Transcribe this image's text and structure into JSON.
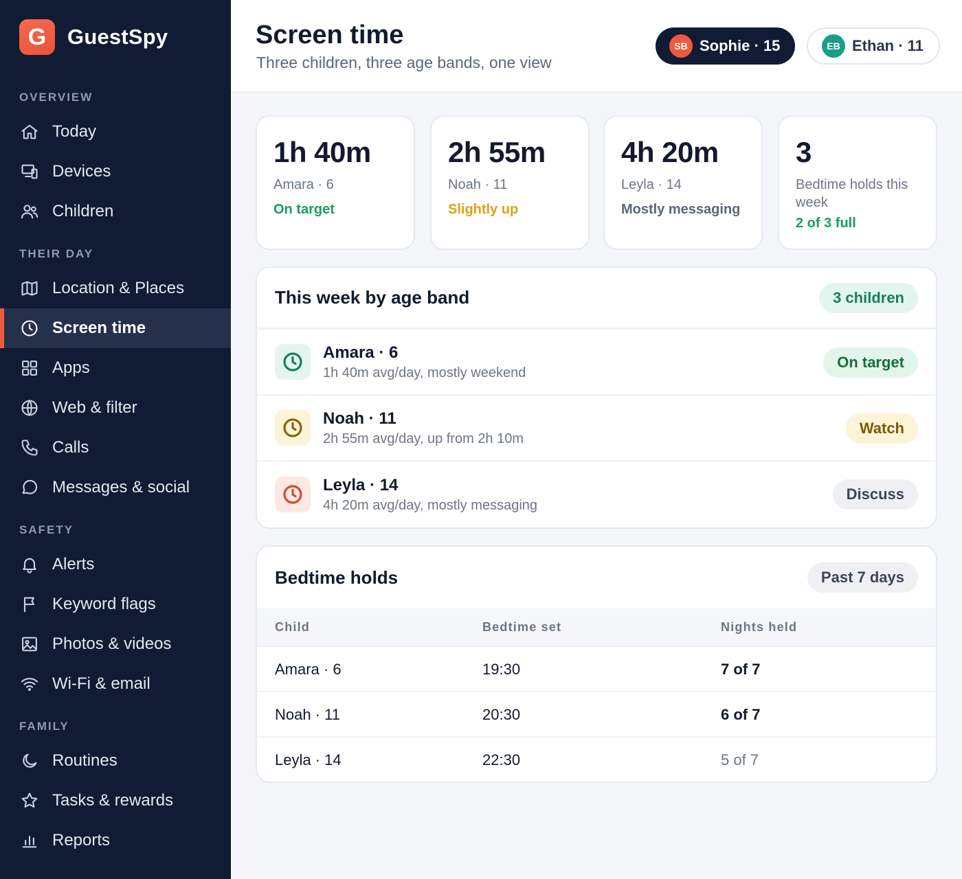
{
  "brand": {
    "logo_letter": "G",
    "name": "GuestSpy"
  },
  "sidebar": {
    "sections": [
      {
        "label": "OVERVIEW"
      },
      {
        "label": "THEIR DAY"
      },
      {
        "label": "SAFETY"
      },
      {
        "label": "FAMILY"
      }
    ],
    "items": [
      {
        "label": "Today",
        "icon": "home-icon"
      },
      {
        "label": "Devices",
        "icon": "devices-icon"
      },
      {
        "label": "Children",
        "icon": "users-icon"
      },
      {
        "label": "Location & Places",
        "icon": "map-icon"
      },
      {
        "label": "Screen time",
        "icon": "clock-icon",
        "active": true
      },
      {
        "label": "Apps",
        "icon": "grid-icon"
      },
      {
        "label": "Web & filter",
        "icon": "globe-icon"
      },
      {
        "label": "Calls",
        "icon": "phone-icon"
      },
      {
        "label": "Messages & social",
        "icon": "chat-icon"
      },
      {
        "label": "Alerts",
        "icon": "bell-icon"
      },
      {
        "label": "Keyword flags",
        "icon": "flag-icon"
      },
      {
        "label": "Photos & videos",
        "icon": "image-icon"
      },
      {
        "label": "Wi-Fi & email",
        "icon": "wifi-icon"
      },
      {
        "label": "Routines",
        "icon": "moon-icon"
      },
      {
        "label": "Tasks & rewards",
        "icon": "star-icon"
      },
      {
        "label": "Reports",
        "icon": "bar-chart-icon"
      }
    ]
  },
  "header": {
    "title": "Screen time",
    "subtitle": "Three children, three age bands, one view",
    "profiles": [
      {
        "initials": "SB",
        "label": "Sophie · 15"
      },
      {
        "initials": "EB",
        "label": "Ethan · 11"
      }
    ]
  },
  "stats": [
    {
      "value": "1h 40m",
      "label": "Amara · 6",
      "status": "On target"
    },
    {
      "value": "2h 55m",
      "label": "Noah · 11",
      "status": "Slightly up"
    },
    {
      "value": "4h 20m",
      "label": "Leyla · 14",
      "status": "Mostly messaging"
    },
    {
      "value": "3",
      "label": "Bedtime holds this week",
      "status": "2 of 3 full"
    }
  ],
  "age_band": {
    "title": "This week by age band",
    "badge": "3 children",
    "rows": [
      {
        "name": "Amara · 6",
        "desc": "1h 40m avg/day, mostly weekend",
        "badge": "On target"
      },
      {
        "name": "Noah · 11",
        "desc": "2h 55m avg/day, up from 2h 10m",
        "badge": "Watch"
      },
      {
        "name": "Leyla · 14",
        "desc": "4h 20m avg/day, mostly messaging",
        "badge": "Discuss"
      }
    ]
  },
  "bedtime": {
    "title": "Bedtime holds",
    "badge": "Past 7 days",
    "columns": [
      "Child",
      "Bedtime set",
      "Nights held"
    ],
    "rows": [
      {
        "child": "Amara · 6",
        "bedtime": "19:30",
        "nights": "7 of 7"
      },
      {
        "child": "Noah · 11",
        "bedtime": "20:30",
        "nights": "6 of 7"
      },
      {
        "child": "Leyla · 14",
        "bedtime": "22:30",
        "nights": "5 of 7"
      }
    ]
  },
  "colors": {
    "sidebar_bg": "#111b33",
    "accent": "#f05a3e",
    "green": "#17a05a",
    "amber": "#e0a115"
  }
}
